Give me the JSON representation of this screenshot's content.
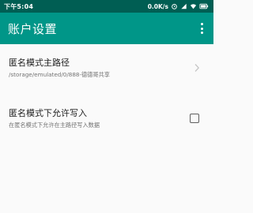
{
  "status_bar": {
    "time": "下午5:04",
    "net_speed": "0.0K/s",
    "icons": [
      "alarm-icon",
      "signal-icon",
      "wifi-icon",
      "battery-icon"
    ]
  },
  "app_bar": {
    "title": "账户设置",
    "overflow_icon": "more-vertical-icon",
    "background": "#009688",
    "status_background": "#005e53"
  },
  "preferences": [
    {
      "title": "匿名模式主路径",
      "summary": "/storage/emulated/0/888-德德哥共享",
      "widget": "chevron-right-icon"
    },
    {
      "title": "匿名模式下允许写入",
      "summary": "在匿名模式下允许在主路径写入数据",
      "widget": "checkbox",
      "checked": false
    }
  ]
}
